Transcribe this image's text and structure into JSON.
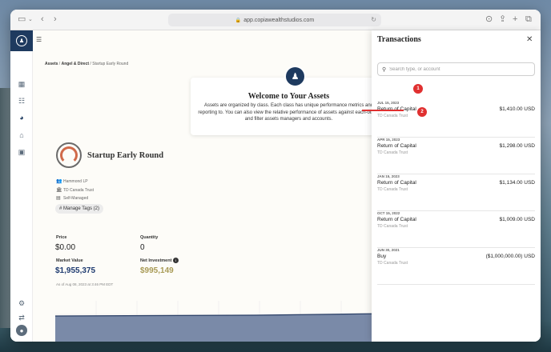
{
  "browser": {
    "url": "app.copiawealthstudios.com",
    "sidebar_toggle_icon": "sidebar-icon",
    "back_icon": "chevron-left-icon",
    "forward_icon": "chevron-right-icon"
  },
  "sidebar": {
    "items": [
      {
        "name": "dashboard",
        "icon": "grid-icon"
      },
      {
        "name": "reports",
        "icon": "list-icon"
      },
      {
        "name": "assets",
        "icon": "pie-chart-icon"
      },
      {
        "name": "accounts",
        "icon": "bank-icon"
      },
      {
        "name": "briefcase",
        "icon": "briefcase-icon"
      }
    ]
  },
  "breadcrumb": {
    "assets": "Assets",
    "sep1": " / ",
    "category": "Angel & Direct",
    "sep2": " / ",
    "current": "Startup Early Round"
  },
  "welcome": {
    "title": "Welcome to Your Assets",
    "body": "Assets are organized by class. Each class has unique performance metrics and reporting to. You can also view the relative performance of assets against each-other, and filter assets managers and accounts."
  },
  "asset": {
    "title": "Startup Early Round",
    "meta": [
      {
        "icon": "people-icon",
        "glyph": "👥",
        "text": "Hammond LP"
      },
      {
        "icon": "bank-icon",
        "glyph": "🏛",
        "text": "TD Canada Trust"
      },
      {
        "icon": "id-card-icon",
        "glyph": "🪪",
        "text": "Self-Managed"
      }
    ],
    "tags_label": "# Manage Tags (2)"
  },
  "stats": {
    "price_label": "Price",
    "price_value": "$0.00",
    "quantity_label": "Quantity",
    "quantity_value": "0",
    "market_value_label": "Market Value",
    "market_value": "$1,955,375",
    "net_investment_label": "Net Investment",
    "net_investment_value": "$995,149",
    "as_of": "As of Aug 08, 2023 at 3:46 PM EDT"
  },
  "transactions": {
    "title": "Transactions",
    "search_placeholder": "Search type, or account",
    "items": [
      {
        "date": "JUL 15, 2023",
        "type": "Return of Capital",
        "account": "TD Canada Trust",
        "amount": "$1,410.00 USD"
      },
      {
        "date": "APR 15, 2023",
        "type": "Return of Capital",
        "account": "TD Canada Trust",
        "amount": "$1,298.00 USD"
      },
      {
        "date": "JAN 15, 2023",
        "type": "Return of Capital",
        "account": "TD Canada Trust",
        "amount": "$1,134.00 USD"
      },
      {
        "date": "OCT 15, 2022",
        "type": "Return of Capital",
        "account": "TD Canada Trust",
        "amount": "$1,009.00 USD"
      },
      {
        "date": "JUN 30, 2021",
        "type": "Buy",
        "account": "TD Canada Trust",
        "amount": "($1,000,000.00) USD"
      }
    ]
  },
  "annotations": {
    "badge1": "1",
    "badge2": "2"
  },
  "colors": {
    "brand_navy": "#1e3a5f",
    "market_value": "#1e3a6f",
    "net_investment": "#a89a55",
    "annotation": "#e03030"
  }
}
